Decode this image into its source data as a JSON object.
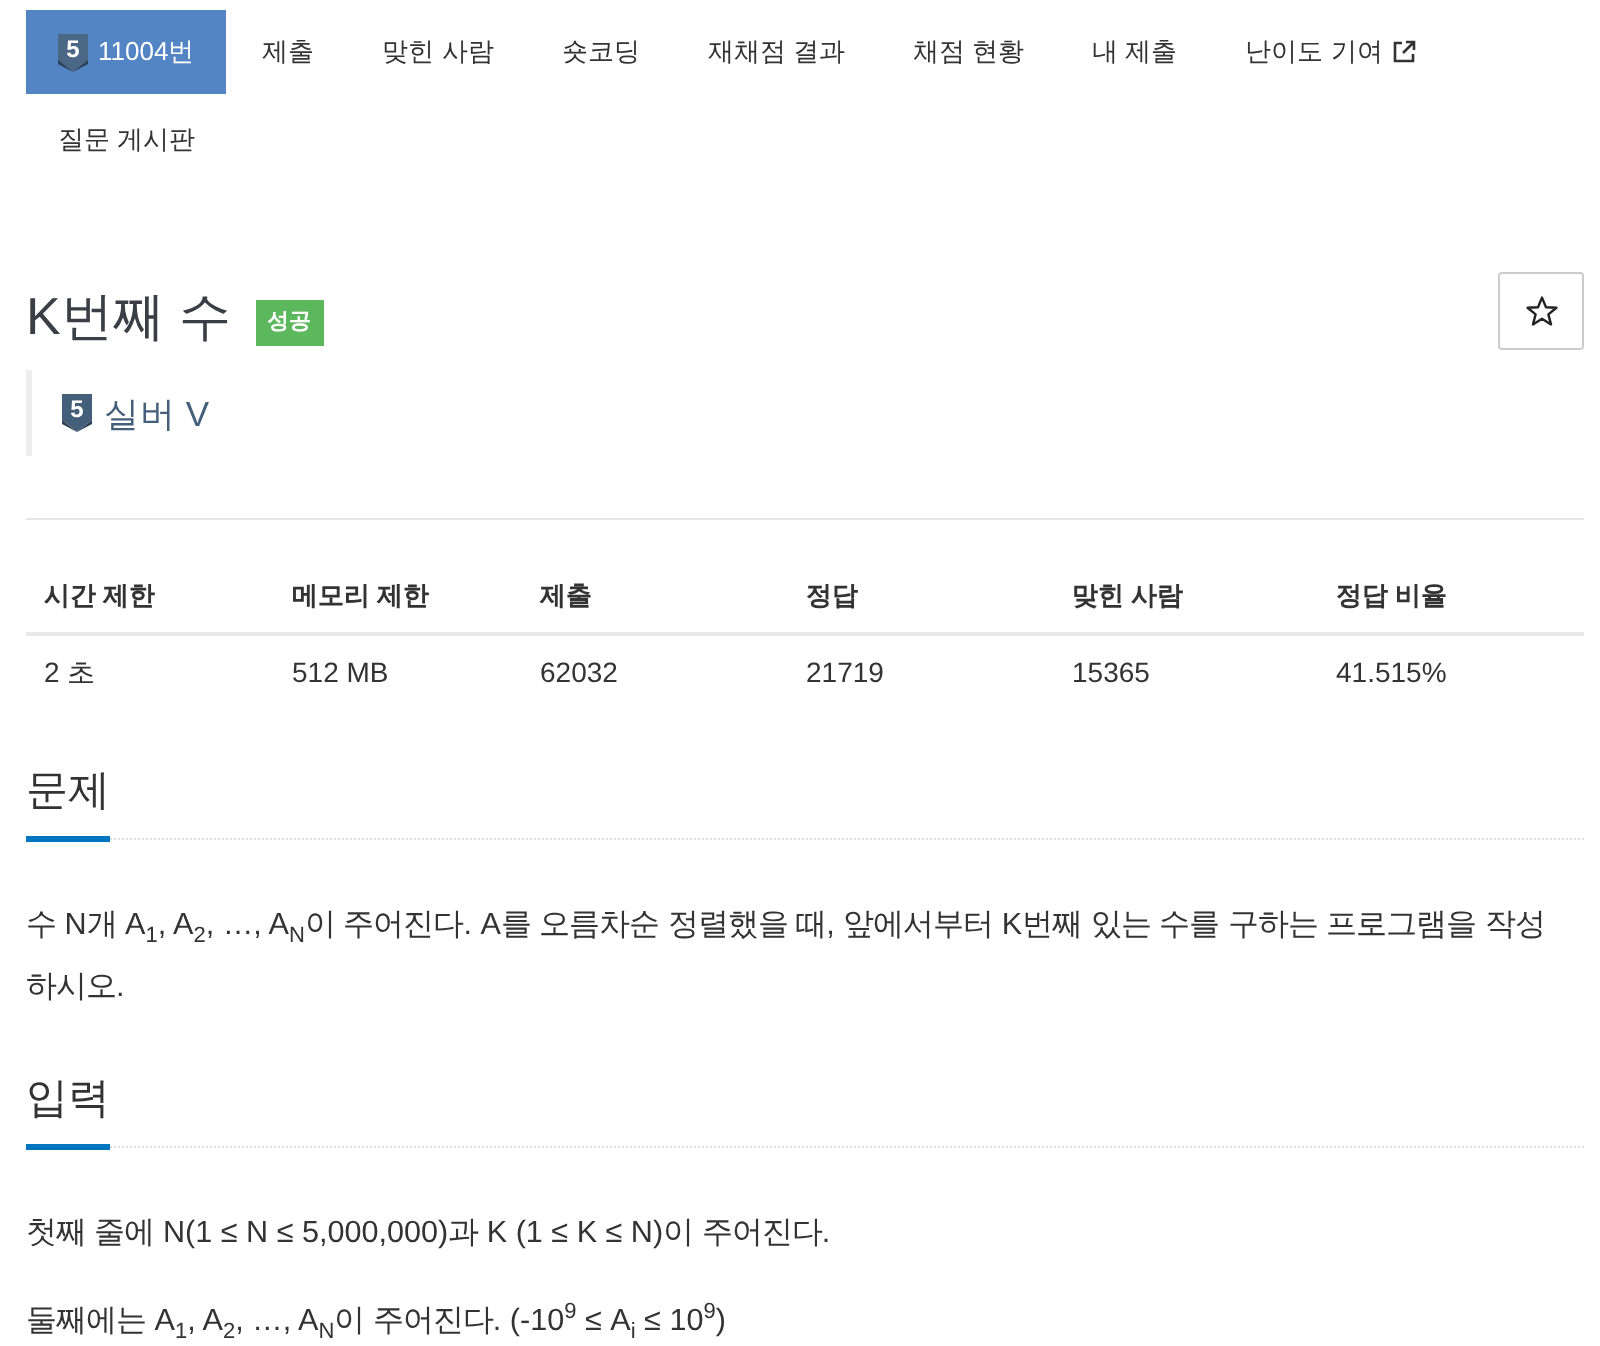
{
  "nav": {
    "tabs": [
      {
        "label": "11004번",
        "selected": true,
        "kind": "problem",
        "tier_badge": "5"
      },
      {
        "label": "제출",
        "selected": false,
        "kind": "plain"
      },
      {
        "label": "맞힌 사람",
        "selected": false,
        "kind": "plain"
      },
      {
        "label": "숏코딩",
        "selected": false,
        "kind": "plain"
      },
      {
        "label": "재채점 결과",
        "selected": false,
        "kind": "plain"
      },
      {
        "label": "채점 현황",
        "selected": false,
        "kind": "plain"
      },
      {
        "label": "내 제출",
        "selected": false,
        "kind": "plain"
      },
      {
        "label": "난이도 기여",
        "selected": false,
        "kind": "external"
      },
      {
        "label": "질문 게시판",
        "selected": false,
        "kind": "plain"
      }
    ]
  },
  "title": {
    "text": "K번째 수",
    "result_badge": "성공",
    "starred": false
  },
  "tier": {
    "badge": "5",
    "name": "실버 V"
  },
  "info_table": {
    "columns": [
      "시간 제한",
      "메모리 제한",
      "제출",
      "정답",
      "맞힌 사람",
      "정답 비율"
    ],
    "rows": [
      [
        "2 초",
        "512 MB",
        "62032",
        "21719",
        "15365",
        "41.515%"
      ]
    ]
  },
  "sections": [
    {
      "title": "문제",
      "paragraphs": [
        "수 N개 A$_{1}$, A$_{2}$, …, A$_{N}$이 주어진다. A를 오름차순 정렬했을 때, 앞에서부터 K번째 있는 수를 구하는 프로그램을 작성하시오."
      ]
    },
    {
      "title": "입력",
      "paragraphs": [
        "첫째 줄에 N(1 ≤ N ≤ 5,000,000)과 K (1 ≤ K ≤ N)이 주어진다.",
        "둘째에는 A$_{1}$, A$_{2}$, …, A$_{N}$이 주어진다. (-10$^{9}$ ≤ A$_{i}$ ≤ 10$^{9}$)"
      ]
    }
  ]
}
